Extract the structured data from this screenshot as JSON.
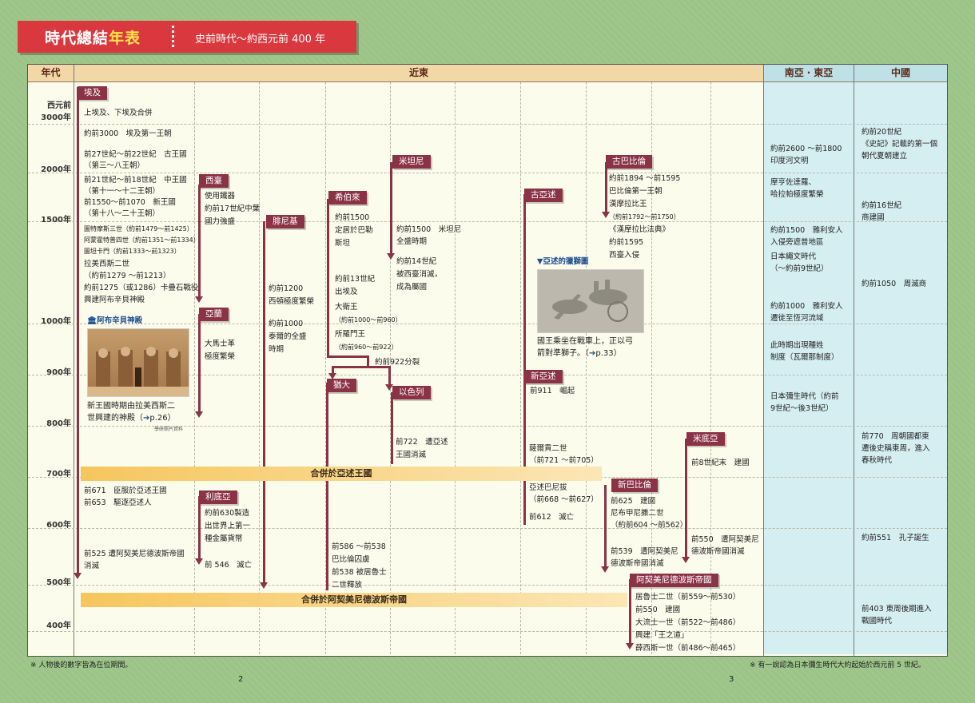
{
  "banner": {
    "title_main": "時代總結",
    "title_accent": "年表",
    "subtitle": "史前時代～約西元前 400 年"
  },
  "headers": {
    "year": "年代",
    "near_east": "近東",
    "south_east_asia": "南亞 ‧ 東亞",
    "china": "中國"
  },
  "years": {
    "y3000a": "西元前",
    "y3000b": "3000年",
    "y2000": "2000年",
    "y1500": "1500年",
    "y1000": "1000年",
    "y900": "900年",
    "y800": "800年",
    "y700": "700年",
    "y600": "600年",
    "y500": "500年",
    "y400": "400年"
  },
  "egypt": {
    "tag": "埃及",
    "l1": "上埃及、下埃及合併",
    "l2": "約前3000　埃及第一王朝",
    "l3": "前27世紀～前22世紀　古王國",
    "l4": "（第三～八王朝）",
    "l5": "前21世紀～前18世紀　中王國",
    "l6": "（第十一～十二王朝）",
    "l7": "前1550～前1070　新王國",
    "l8": "（第十八～二十王朝）",
    "l9": "圖特摩斯三世（約前1479～前1425）",
    "l10": "阿蒙霍特普四世（約前1351～前1334）",
    "l11": "圖坦卡門（約前1333～前1323）",
    "l12": "拉美西斯二世",
    "l13": "（約前1279 ～前1213）",
    "l14": "約前1275（或1286）卡疊石戰役",
    "l15": "興建阿布辛貝神殿",
    "photo_title": "阿布辛貝神殿",
    "cap1": "新王國時期由拉美西斯二",
    "cap2": "世興建的神殿（",
    "cap_ref": "p.26）",
    "credit": "學研照片資料",
    "l16": "前671　臣服於亞述王國",
    "l17": "前653　驅逐亞述人",
    "l18": "前525 遭阿契美尼德波斯帝國",
    "l19": "消滅"
  },
  "hittite": {
    "tag": "西臺",
    "l1": "使用鐵器",
    "l2": "約前17世紀中葉",
    "l3": "國力強盛"
  },
  "aram": {
    "tag": "亞蘭",
    "l1": "大馬士革",
    "l2": "極度繁榮"
  },
  "lydia": {
    "tag": "利底亞",
    "l1": "約前630製造",
    "l2": "出世界上第一",
    "l3": "種金屬貨幣",
    "l4": "前 546　滅亡"
  },
  "phoenicia": {
    "tag": "腓尼基",
    "l1": "約前1200",
    "l2": "西頓極度繁榮",
    "l3": "約前1000",
    "l4": "泰爾的全盛",
    "l5": "時期"
  },
  "hebrew": {
    "tag": "希伯來",
    "l1": "約前1500",
    "l2": "定居於巴勒",
    "l3": "斯坦",
    "l4": "約前13世紀",
    "l5": "出埃及",
    "l6": "大衛王",
    "l7": "（約前1000～前960）",
    "l8": "所羅門王",
    "l9": "（約前960～前922）",
    "l10": "約前922分裂"
  },
  "judah": {
    "tag": "猶大",
    "l1": "前586 ～前538",
    "l2": "巴比倫囚虜",
    "l3": "前538 被居魯士",
    "l4": "二世釋放"
  },
  "israel": {
    "tag": "以色列",
    "l1": "前722　遭亞述",
    "l2": "王國消滅"
  },
  "mitanni": {
    "tag": "米坦尼",
    "l1": "約前1500　米坦尼",
    "l2": "全盛時期",
    "l3": "約前14世紀",
    "l4": "被西臺消滅，",
    "l5": "成為屬國"
  },
  "assyria": {
    "tag": "古亞述",
    "photo_title": "亞述的獵獅圖",
    "cap1": "國王乘坐在戰車上，正以弓",
    "cap2": "箭對準獅子。（",
    "cap_ref": "p.33）"
  },
  "neo_assyria": {
    "tag": "新亞述",
    "l1": "前911　崛起",
    "l2": "薩爾貢二世",
    "l3": "（前721 ～前705）",
    "l4": "亞述巴尼拔",
    "l5": "（前668 ～前627）",
    "l6": "前612　滅亡"
  },
  "old_babylon": {
    "tag": "古巴比倫",
    "l1": "約前1894 ～前1595",
    "l2": "巴比倫第一王朝",
    "l3": "漢摩拉比王",
    "l4": "（約前1792～前1750）",
    "l5": "《漢摩拉比法典》",
    "l6": "約前1595",
    "l7": "西臺入侵"
  },
  "neo_babylon": {
    "tag": "新巴比倫",
    "l1": "前625　建國",
    "l2": "尼布甲尼撒二世",
    "l3": "（約前604 ～前562）",
    "l4": "前539　遭阿契美尼",
    "l5": "德波斯帝國消滅"
  },
  "media": {
    "tag": "米底亞",
    "l1": "前8世紀末　建國",
    "l2": "前550　遭阿契美尼",
    "l3": "德波斯帝國消滅"
  },
  "persia": {
    "tag": "阿契美尼德波斯帝國",
    "l1": "居魯士二世（前559～前530）",
    "l2": "前550　建國",
    "l3": "大流士一世（前522～前486）",
    "l4": "興建「王之道」",
    "l5": "薛西斯一世（前486～前465）"
  },
  "merges": {
    "assyria": "合併於亞述王國",
    "persia": "合併於阿契美尼德波斯帝國"
  },
  "south_asia": {
    "l1": "約前2600 ～前1800",
    "l2": "印度河文明",
    "l3": "摩亨佐達羅、",
    "l4": "哈拉帕極度繁榮",
    "l5": "約前1500　雅利安人",
    "l6": "入侵旁遮普地區",
    "l7": "日本繩文時代",
    "l8": "（～約前9世紀）",
    "l9": "約前1000　雅利安人",
    "l10": "遷徙至恆河流域",
    "l11": "此時期出現種姓",
    "l12": "制度（瓦爾那制度）",
    "l13": "日本彌生時代（約前",
    "l14": "9世紀～後3世紀）"
  },
  "china": {
    "l1": "約前20世紀",
    "l2": "《史記》記載的第一個",
    "l3": "朝代夏朝建立",
    "l4": "約前16世紀",
    "l5": "商建國",
    "l6": "約前1050　周滅商",
    "l7": "前770　周朝國都東",
    "l8": "遷後史稱東周，進入",
    "l9": "春秋時代",
    "l10": "約前551　孔子誕生",
    "l11": "前403 東周後期進入",
    "l12": "戰國時代"
  },
  "footer": {
    "left": "※ 人物後的數字皆為在位期間。",
    "right": "※ 有一說認為日本彌生時代大約起始於西元前 5 世紀。",
    "page_left": "2",
    "page_right": "3"
  },
  "colors": {
    "banner": "#d9393e",
    "accent": "#ffe34a",
    "tag": "#8b3346",
    "header": "#f2d8a6",
    "asia_column": "#d5eef2",
    "merge": "#f6c65d"
  }
}
